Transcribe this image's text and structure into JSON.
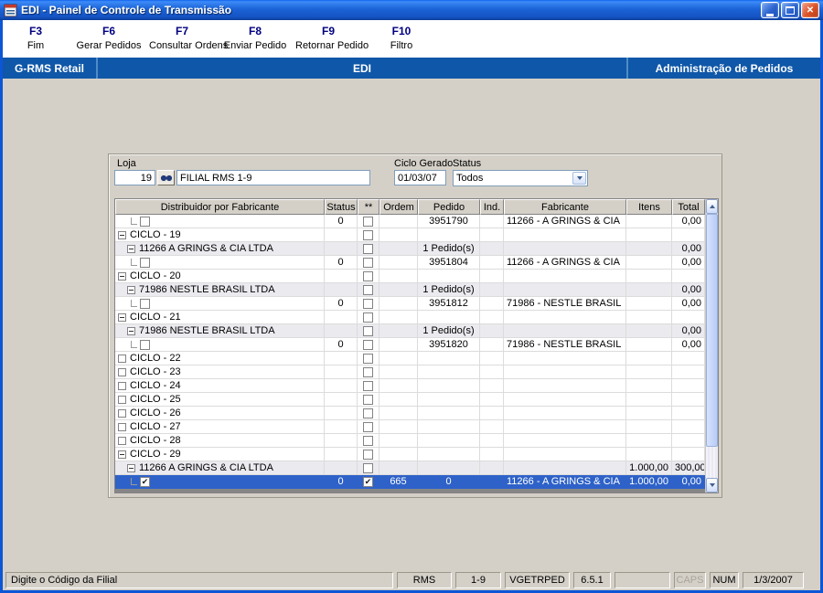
{
  "window": {
    "title": "EDI - Painel de Controle de Transmissão"
  },
  "toolbar": {
    "items": [
      {
        "key": "F3",
        "label": "Fim"
      },
      {
        "key": "F6",
        "label": "Gerar Pedidos"
      },
      {
        "key": "F7",
        "label": "Consultar Ordens"
      },
      {
        "key": "F8",
        "label": "Enviar Pedido"
      },
      {
        "key": "F9",
        "label": "Retornar Pedido"
      },
      {
        "key": "F10",
        "label": "Filtro"
      }
    ]
  },
  "header": {
    "left": "G-RMS Retail",
    "center": "EDI",
    "right": "Administração de Pedidos"
  },
  "filters": {
    "loja_label": "Loja",
    "loja_code": "19",
    "loja_name": "FILIAL RMS 1-9",
    "ciclo_label": "Ciclo Gerado",
    "ciclo_value": "01/03/07",
    "status_label": "Status",
    "status_value": "Todos"
  },
  "grid": {
    "columns": [
      "Distribuidor por Fabricante",
      "Status",
      "**",
      "Ordem",
      "Pedido",
      "Ind.",
      "Fabricante",
      "Itens",
      "Total"
    ],
    "rows": [
      {
        "type": "detail",
        "selected": false,
        "check": false,
        "label": "",
        "expanded": false,
        "status": "0",
        "star": false,
        "ordem": "",
        "pedido": "3951790",
        "ind": "",
        "fabricante": "11266 - A GRINGS & CIA",
        "itens": "",
        "total": "0,00"
      },
      {
        "type": "ciclo",
        "selected": false,
        "check": false,
        "label": "CICLO - 19",
        "expanded": true,
        "status": "",
        "star": false,
        "ordem": "",
        "pedido": "",
        "ind": "",
        "fabricante": "",
        "itens": "",
        "total": ""
      },
      {
        "type": "fab",
        "selected": false,
        "check": false,
        "label": "11266 A GRINGS & CIA LTDA",
        "expanded": true,
        "status": "",
        "star": false,
        "ordem": "",
        "pedido": "1 Pedido(s)",
        "ind": "",
        "fabricante": "",
        "itens": "",
        "total": "0,00"
      },
      {
        "type": "detail",
        "selected": false,
        "check": false,
        "label": "",
        "expanded": false,
        "status": "0",
        "star": false,
        "ordem": "",
        "pedido": "3951804",
        "ind": "",
        "fabricante": "11266 - A GRINGS & CIA",
        "itens": "",
        "total": "0,00"
      },
      {
        "type": "ciclo",
        "selected": false,
        "check": false,
        "label": "CICLO - 20",
        "expanded": true,
        "status": "",
        "star": false,
        "ordem": "",
        "pedido": "",
        "ind": "",
        "fabricante": "",
        "itens": "",
        "total": ""
      },
      {
        "type": "fab",
        "selected": false,
        "check": false,
        "label": "71986 NESTLE BRASIL LTDA",
        "expanded": true,
        "status": "",
        "star": false,
        "ordem": "",
        "pedido": "1 Pedido(s)",
        "ind": "",
        "fabricante": "",
        "itens": "",
        "total": "0,00"
      },
      {
        "type": "detail",
        "selected": false,
        "check": false,
        "label": "",
        "expanded": false,
        "status": "0",
        "star": false,
        "ordem": "",
        "pedido": "3951812",
        "ind": "",
        "fabricante": "71986 - NESTLE BRASIL",
        "itens": "",
        "total": "0,00"
      },
      {
        "type": "ciclo",
        "selected": false,
        "check": false,
        "label": "CICLO - 21",
        "expanded": true,
        "status": "",
        "star": false,
        "ordem": "",
        "pedido": "",
        "ind": "",
        "fabricante": "",
        "itens": "",
        "total": ""
      },
      {
        "type": "fab",
        "selected": false,
        "check": false,
        "label": "71986 NESTLE BRASIL LTDA",
        "expanded": true,
        "status": "",
        "star": false,
        "ordem": "",
        "pedido": "1 Pedido(s)",
        "ind": "",
        "fabricante": "",
        "itens": "",
        "total": "0,00"
      },
      {
        "type": "detail",
        "selected": false,
        "check": false,
        "label": "",
        "expanded": false,
        "status": "0",
        "star": false,
        "ordem": "",
        "pedido": "3951820",
        "ind": "",
        "fabricante": "71986 - NESTLE BRASIL",
        "itens": "",
        "total": "0,00"
      },
      {
        "type": "ciclo",
        "selected": false,
        "check": false,
        "label": "CICLO - 22",
        "expanded": false,
        "status": "",
        "star": false,
        "ordem": "",
        "pedido": "",
        "ind": "",
        "fabricante": "",
        "itens": "",
        "total": ""
      },
      {
        "type": "ciclo",
        "selected": false,
        "check": false,
        "label": "CICLO - 23",
        "expanded": false,
        "status": "",
        "star": false,
        "ordem": "",
        "pedido": "",
        "ind": "",
        "fabricante": "",
        "itens": "",
        "total": ""
      },
      {
        "type": "ciclo",
        "selected": false,
        "check": false,
        "label": "CICLO - 24",
        "expanded": false,
        "status": "",
        "star": false,
        "ordem": "",
        "pedido": "",
        "ind": "",
        "fabricante": "",
        "itens": "",
        "total": ""
      },
      {
        "type": "ciclo",
        "selected": false,
        "check": false,
        "label": "CICLO - 25",
        "expanded": false,
        "status": "",
        "star": false,
        "ordem": "",
        "pedido": "",
        "ind": "",
        "fabricante": "",
        "itens": "",
        "total": ""
      },
      {
        "type": "ciclo",
        "selected": false,
        "check": false,
        "label": "CICLO - 26",
        "expanded": false,
        "status": "",
        "star": false,
        "ordem": "",
        "pedido": "",
        "ind": "",
        "fabricante": "",
        "itens": "",
        "total": ""
      },
      {
        "type": "ciclo",
        "selected": false,
        "check": false,
        "label": "CICLO - 27",
        "expanded": false,
        "status": "",
        "star": false,
        "ordem": "",
        "pedido": "",
        "ind": "",
        "fabricante": "",
        "itens": "",
        "total": ""
      },
      {
        "type": "ciclo",
        "selected": false,
        "check": false,
        "label": "CICLO - 28",
        "expanded": false,
        "status": "",
        "star": false,
        "ordem": "",
        "pedido": "",
        "ind": "",
        "fabricante": "",
        "itens": "",
        "total": ""
      },
      {
        "type": "ciclo",
        "selected": false,
        "check": false,
        "label": "CICLO - 29",
        "expanded": true,
        "status": "",
        "star": false,
        "ordem": "",
        "pedido": "",
        "ind": "",
        "fabricante": "",
        "itens": "",
        "total": ""
      },
      {
        "type": "fab",
        "selected": false,
        "check": false,
        "label": "11266 A GRINGS & CIA LTDA",
        "expanded": true,
        "status": "",
        "star": false,
        "ordem": "",
        "pedido": "",
        "ind": "",
        "fabricante": "",
        "itens": "1.000,00",
        "total": "300,00"
      },
      {
        "type": "detail",
        "selected": true,
        "check": true,
        "label": "",
        "expanded": false,
        "status": "0",
        "star": true,
        "ordem": "665",
        "pedido": "0",
        "ind": "",
        "fabricante": "11266 - A GRINGS & CIA",
        "itens": "1.000,00",
        "total": "0,00"
      }
    ]
  },
  "statusbar": {
    "message": "Digite o Código da Filial",
    "panels": [
      {
        "label": "RMS",
        "enabled": true
      },
      {
        "label": "1-9",
        "enabled": true
      },
      {
        "label": "VGETRPED",
        "enabled": true
      },
      {
        "label": "6.5.1",
        "enabled": true
      },
      {
        "label": "",
        "enabled": true
      },
      {
        "label": "CAPS",
        "enabled": false
      },
      {
        "label": "NUM",
        "enabled": true
      },
      {
        "label": "1/3/2007",
        "enabled": true
      }
    ]
  },
  "icons": {
    "app-icon": "form-window-glyph",
    "minimize-icon": "_",
    "restore-icon": "❐",
    "close-icon": "✕",
    "binoculars-icon": "two dark lenses",
    "dropdown-arrow-icon": "▼",
    "arrow-up-icon": "▲",
    "arrow-down-icon": "▼",
    "collapse-icon": "⊟",
    "expand-icon": "⊞",
    "checkbox-checked-icon": "✔"
  },
  "colors": {
    "titlebar_blue": "#1a5fd0",
    "band_blue": "#0f57a8",
    "selection_blue": "#2e62c8",
    "function_key_navy": "#000080",
    "window_gray": "#d4d0c8"
  }
}
